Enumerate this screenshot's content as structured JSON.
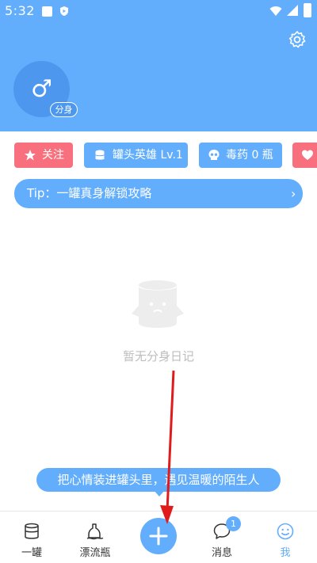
{
  "status_bar": {
    "time": "5:32"
  },
  "profile": {
    "avatar_symbol": "♂",
    "avatar_badge": "分身"
  },
  "chips": {
    "follow": "关注",
    "level": "罐头英雄 Lv.1",
    "poison": "毒药 0 瓶"
  },
  "tip": {
    "text": "Tip：一罐真身解锁攻略",
    "arrow": "›"
  },
  "empty_state": {
    "text": "暂无分身日记"
  },
  "hint_bubble": {
    "text": "把心情装进罐头里，遇见温暖的陌生人"
  },
  "tabs": {
    "home": "一罐",
    "bottle": "漂流瓶",
    "messages": "消息",
    "messages_badge": "1",
    "me": "我"
  },
  "colors": {
    "primary": "#62aefc",
    "pink": "#f86f7d",
    "annotation": "#e01b1b"
  }
}
